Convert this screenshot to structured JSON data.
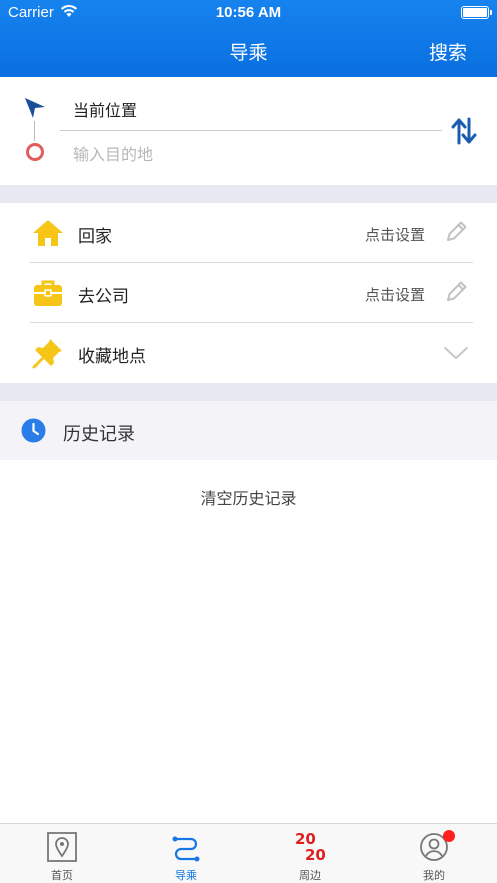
{
  "status_bar": {
    "carrier": "Carrier",
    "time": "10:56 AM"
  },
  "nav": {
    "title": "导乘",
    "search_label": "搜索"
  },
  "route": {
    "start_label": "当前位置",
    "destination_placeholder": "输入目的地"
  },
  "places": [
    {
      "label": "回家",
      "action": "点击设置",
      "icon": "home-icon"
    },
    {
      "label": "去公司",
      "action": "点击设置",
      "icon": "briefcase-icon"
    },
    {
      "label": "收藏地点",
      "icon": "pin-icon"
    }
  ],
  "history": {
    "title": "历史记录",
    "clear_label": "清空历史记录"
  },
  "tabs": [
    {
      "label": "首页",
      "icon": "map-pin-icon"
    },
    {
      "label": "导乘",
      "icon": "route-icon",
      "active": true
    },
    {
      "label": "周边",
      "icon": "year-2020-icon",
      "icon_text_top": "20",
      "icon_text_bottom": "20"
    },
    {
      "label": "我的",
      "icon": "profile-icon",
      "badge": true
    }
  ],
  "colors": {
    "brand_blue": "#0a6fe0",
    "accent_yellow": "#f5c518",
    "badge_red": "#ff1f1f",
    "end_marker_red": "#e35b5b",
    "swap_blue": "#1a5cb0"
  }
}
